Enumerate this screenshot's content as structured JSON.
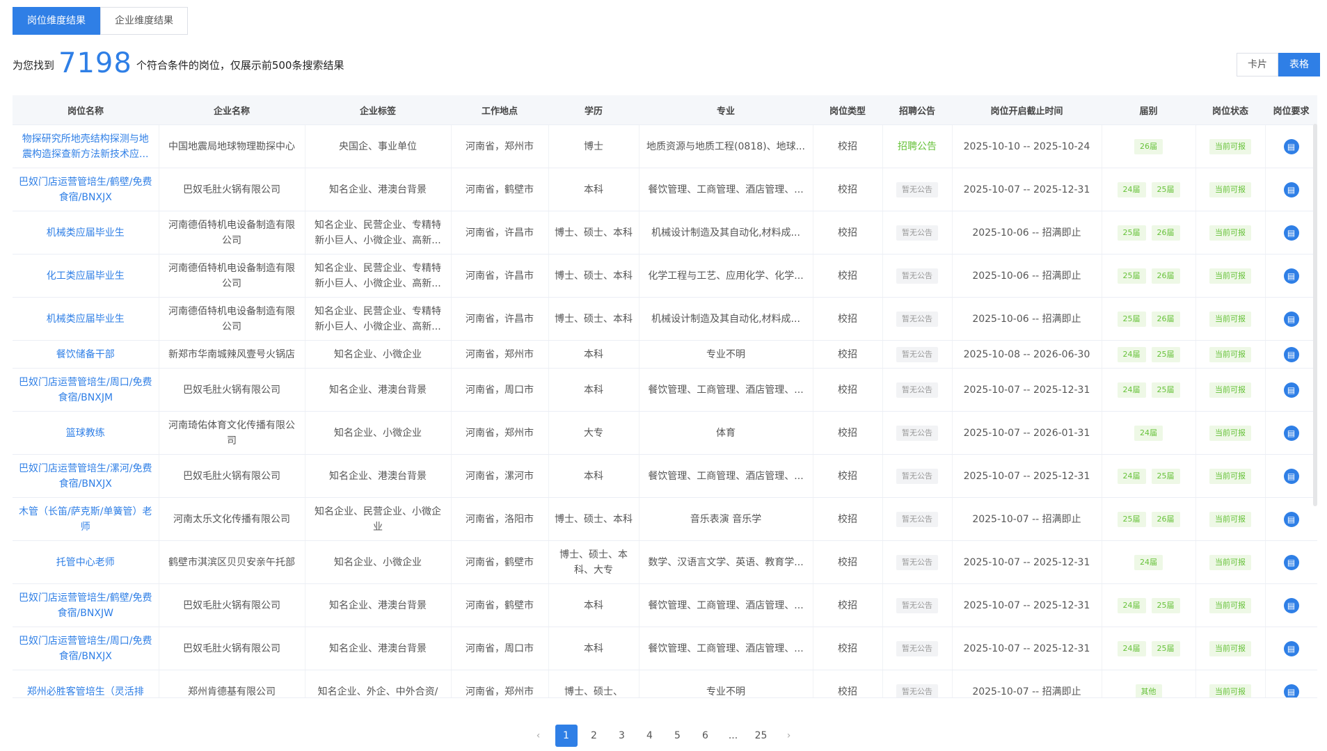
{
  "tabs": [
    "岗位维度结果",
    "企业维度结果"
  ],
  "summary": {
    "prefix": "为您找到",
    "count": "7198",
    "suffix": "个符合条件的岗位，仅展示前500条搜索结果"
  },
  "view_toggle": {
    "card": "卡片",
    "table": "表格"
  },
  "table": {
    "columns": [
      "岗位名称",
      "企业名称",
      "企业标签",
      "工作地点",
      "学历",
      "专业",
      "岗位类型",
      "招聘公告",
      "岗位开启截止时间",
      "届别",
      "岗位状态",
      "岗位要求"
    ],
    "rows": [
      {
        "title": "物探研究所地壳结构探测与地震构造探查新方法新技术应...",
        "company": "中国地震局地球物理勘探中心",
        "tags": "央国企、事业单位",
        "location": "河南省，郑州市",
        "education": "博士",
        "major": "地质资源与地质工程(0818)、地球...",
        "type": "校招",
        "announcement": "招聘公告",
        "announcement_link": true,
        "period": "2025-10-10 -- 2025-10-24",
        "grades": [
          "26届"
        ],
        "status": "当前可报"
      },
      {
        "title": "巴奴门店运营管培生/鹤壁/免费食宿/BNXJX",
        "company": "巴奴毛肚火锅有限公司",
        "tags": "知名企业、港澳台背景",
        "location": "河南省，鹤壁市",
        "education": "本科",
        "major": "餐饮管理、工商管理、酒店管理、...",
        "type": "校招",
        "announcement": "暂无公告",
        "announcement_link": false,
        "period": "2025-10-07 -- 2025-12-31",
        "grades": [
          "24届",
          "25届"
        ],
        "status": "当前可报"
      },
      {
        "title": "机械类应届毕业生",
        "company": "河南德佰特机电设备制造有限公司",
        "tags": "知名企业、民营企业、专精特新小巨人、小微企业、高新...",
        "location": "河南省，许昌市",
        "education": "博士、硕士、本科",
        "major": "机械设计制造及其自动化,材料成...",
        "type": "校招",
        "announcement": "暂无公告",
        "announcement_link": false,
        "period": "2025-10-06 -- 招满即止",
        "grades": [
          "25届",
          "26届"
        ],
        "status": "当前可报"
      },
      {
        "title": "化工类应届毕业生",
        "company": "河南德佰特机电设备制造有限公司",
        "tags": "知名企业、民营企业、专精特新小巨人、小微企业、高新...",
        "location": "河南省，许昌市",
        "education": "博士、硕士、本科",
        "major": "化学工程与工艺、应用化学、化学...",
        "type": "校招",
        "announcement": "暂无公告",
        "announcement_link": false,
        "period": "2025-10-06 -- 招满即止",
        "grades": [
          "25届",
          "26届"
        ],
        "status": "当前可报"
      },
      {
        "title": "机械类应届毕业生",
        "company": "河南德佰特机电设备制造有限公司",
        "tags": "知名企业、民营企业、专精特新小巨人、小微企业、高新...",
        "location": "河南省，许昌市",
        "education": "博士、硕士、本科",
        "major": "机械设计制造及其自动化,材料成...",
        "type": "校招",
        "announcement": "暂无公告",
        "announcement_link": false,
        "period": "2025-10-06 -- 招满即止",
        "grades": [
          "25届",
          "26届"
        ],
        "status": "当前可报"
      },
      {
        "title": "餐饮储备干部",
        "company": "新郑市华南城辣风壹号火锅店",
        "tags": "知名企业、小微企业",
        "location": "河南省，郑州市",
        "education": "本科",
        "major": "专业不明",
        "type": "校招",
        "announcement": "暂无公告",
        "announcement_link": false,
        "period": "2025-10-08 -- 2026-06-30",
        "grades": [
          "24届",
          "25届"
        ],
        "status": "当前可报"
      },
      {
        "title": "巴奴门店运营管培生/周口/免费食宿/BNXJM",
        "company": "巴奴毛肚火锅有限公司",
        "tags": "知名企业、港澳台背景",
        "location": "河南省，周口市",
        "education": "本科",
        "major": "餐饮管理、工商管理、酒店管理、...",
        "type": "校招",
        "announcement": "暂无公告",
        "announcement_link": false,
        "period": "2025-10-07 -- 2025-12-31",
        "grades": [
          "24届",
          "25届"
        ],
        "status": "当前可报"
      },
      {
        "title": "篮球教练",
        "company": "河南琦佑体育文化传播有限公司",
        "tags": "知名企业、小微企业",
        "location": "河南省，郑州市",
        "education": "大专",
        "major": "体育",
        "type": "校招",
        "announcement": "暂无公告",
        "announcement_link": false,
        "period": "2025-10-07 -- 2026-01-31",
        "grades": [
          "24届"
        ],
        "status": "当前可报"
      },
      {
        "title": "巴奴门店运营管培生/漯河/免费食宿/BNXJX",
        "company": "巴奴毛肚火锅有限公司",
        "tags": "知名企业、港澳台背景",
        "location": "河南省，漯河市",
        "education": "本科",
        "major": "餐饮管理、工商管理、酒店管理、...",
        "type": "校招",
        "announcement": "暂无公告",
        "announcement_link": false,
        "period": "2025-10-07 -- 2025-12-31",
        "grades": [
          "24届",
          "25届"
        ],
        "status": "当前可报"
      },
      {
        "title": "木管（长笛/萨克斯/单簧管）老师",
        "company": "河南太乐文化传播有限公司",
        "tags": "知名企业、民营企业、小微企业",
        "location": "河南省，洛阳市",
        "education": "博士、硕士、本科",
        "major": "音乐表演 音乐学",
        "type": "校招",
        "announcement": "暂无公告",
        "announcement_link": false,
        "period": "2025-10-07 -- 招满即止",
        "grades": [
          "25届",
          "26届"
        ],
        "status": "当前可报"
      },
      {
        "title": "托管中心老师",
        "company": "鹤壁市淇滨区贝贝安亲午托部",
        "tags": "知名企业、小微企业",
        "location": "河南省，鹤壁市",
        "education": "博士、硕士、本科、大专",
        "major": "数学、汉语言文学、英语、教育学...",
        "type": "校招",
        "announcement": "暂无公告",
        "announcement_link": false,
        "period": "2025-10-07 -- 2025-12-31",
        "grades": [
          "24届"
        ],
        "status": "当前可报"
      },
      {
        "title": "巴奴门店运营管培生/鹤壁/免费食宿/BNXJW",
        "company": "巴奴毛肚火锅有限公司",
        "tags": "知名企业、港澳台背景",
        "location": "河南省，鹤壁市",
        "education": "本科",
        "major": "餐饮管理、工商管理、酒店管理、...",
        "type": "校招",
        "announcement": "暂无公告",
        "announcement_link": false,
        "period": "2025-10-07 -- 2025-12-31",
        "grades": [
          "24届",
          "25届"
        ],
        "status": "当前可报"
      },
      {
        "title": "巴奴门店运营管培生/周口/免费食宿/BNXJX",
        "company": "巴奴毛肚火锅有限公司",
        "tags": "知名企业、港澳台背景",
        "location": "河南省，周口市",
        "education": "本科",
        "major": "餐饮管理、工商管理、酒店管理、...",
        "type": "校招",
        "announcement": "暂无公告",
        "announcement_link": false,
        "period": "2025-10-07 -- 2025-12-31",
        "grades": [
          "24届",
          "25届"
        ],
        "status": "当前可报"
      },
      {
        "title": "郑州必胜客管培生（灵活排",
        "company": "郑州肯德基有限公司",
        "tags": "知名企业、外企、中外合资/",
        "location": "河南省，郑州市",
        "education": "博士、硕士、",
        "major": "专业不明",
        "type": "校招",
        "announcement": "暂无公告",
        "announcement_link": false,
        "period": "2025-10-07 -- 招满即止",
        "grades": [
          "其他"
        ],
        "status": "当前可报"
      }
    ]
  },
  "pagination": {
    "pages": [
      "1",
      "2",
      "3",
      "4",
      "5",
      "6",
      "...",
      "25"
    ],
    "current": "1"
  },
  "colors": {
    "primary": "#2f7fe6",
    "green": "#67c23a"
  }
}
